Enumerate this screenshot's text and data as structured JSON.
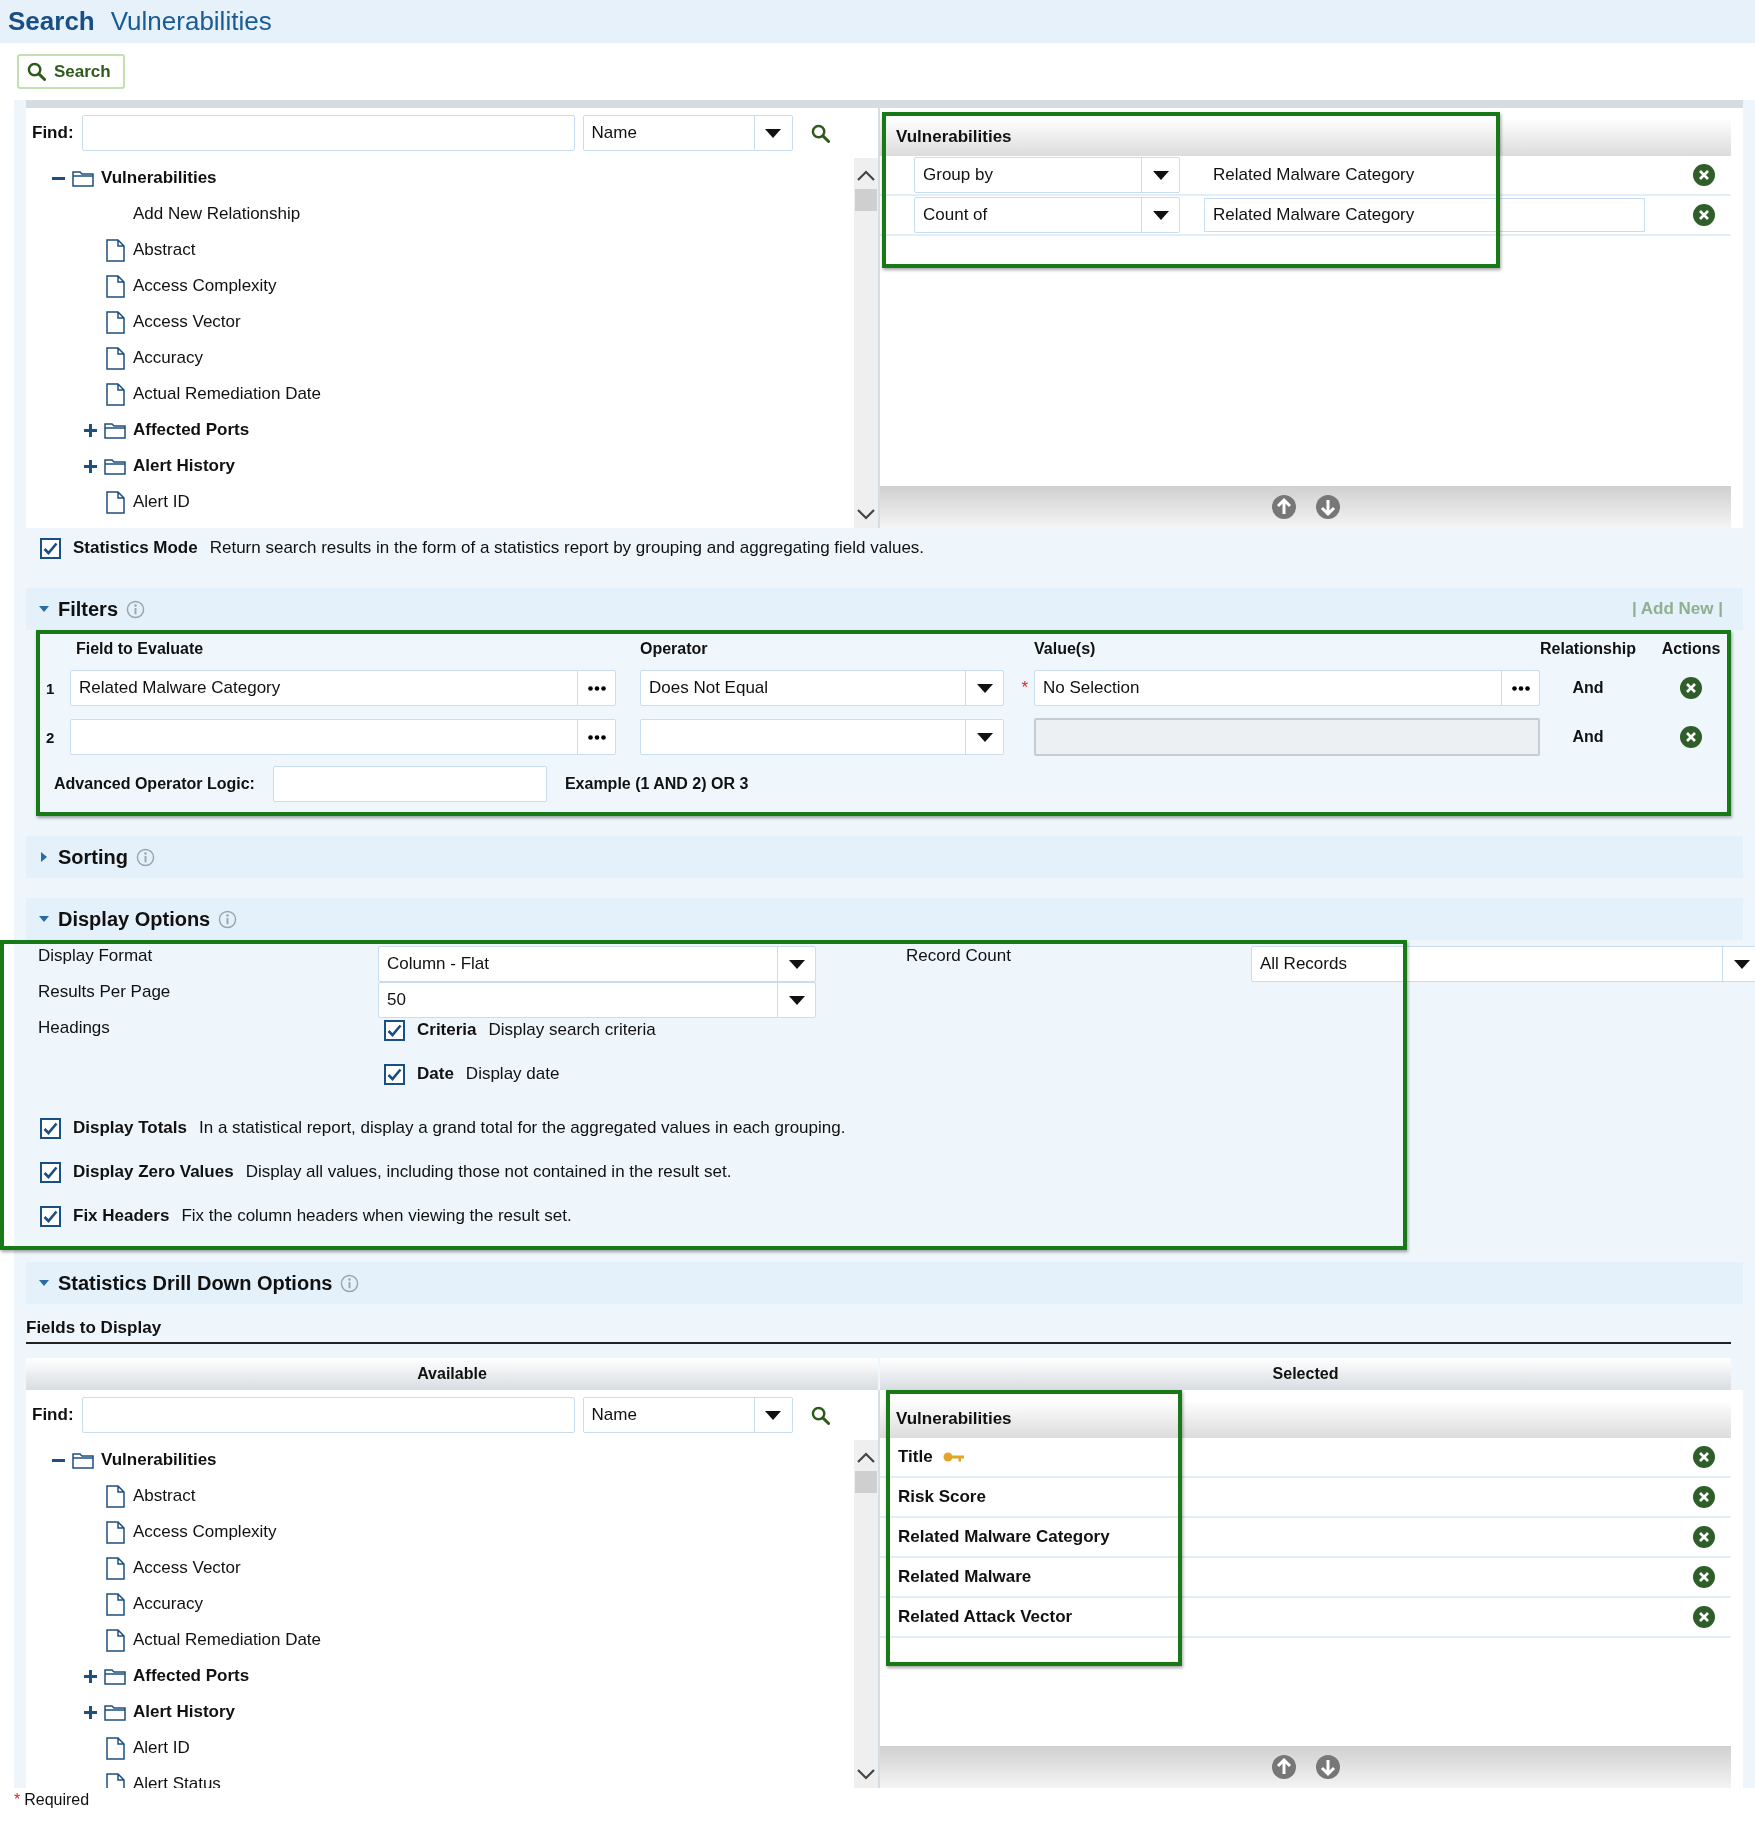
{
  "header": {
    "title": "Search",
    "subtitle": "Vulnerabilities"
  },
  "toolbar": {
    "search_button": "Search"
  },
  "field_selection": {
    "find": {
      "label": "Find:",
      "search_by": "Name"
    },
    "tree": [
      {
        "kind": "folder",
        "label": "Vulnerabilities",
        "expanded": true,
        "children": [
          {
            "kind": "action",
            "label": "Add New Relationship"
          },
          {
            "kind": "field",
            "label": "Abstract"
          },
          {
            "kind": "field",
            "label": "Access Complexity"
          },
          {
            "kind": "field",
            "label": "Access Vector"
          },
          {
            "kind": "field",
            "label": "Accuracy"
          },
          {
            "kind": "field",
            "label": "Actual Remediation Date"
          },
          {
            "kind": "folder",
            "label": "Affected Ports",
            "expanded": false
          },
          {
            "kind": "folder",
            "label": "Alert History",
            "expanded": false
          },
          {
            "kind": "field",
            "label": "Alert ID"
          }
        ]
      }
    ],
    "selected": {
      "title": "Vulnerabilities",
      "rows": [
        {
          "mode": "Group by",
          "field": "Related Malware Category",
          "editable": false
        },
        {
          "mode": "Count of",
          "field": "Related Malware Category",
          "editable": true
        }
      ]
    }
  },
  "statistics_mode": {
    "checked": true,
    "label": "Statistics Mode",
    "description": "Return search results in the form of a statistics report by grouping and aggregating field values."
  },
  "filters": {
    "title": "Filters",
    "expanded": true,
    "add_new": "| Add New |",
    "required_mark": "*",
    "columns": [
      "Field to Evaluate",
      "Operator",
      "Value(s)",
      "Relationship",
      "Actions"
    ],
    "rows": [
      {
        "number": "1",
        "field": "Related Malware Category",
        "operator": "Does Not Equal",
        "required": true,
        "value": "No Selection",
        "value_disabled": false,
        "relationship": "And"
      },
      {
        "number": "2",
        "value_disabled": true,
        "relationship": "And"
      }
    ],
    "advanced_logic": {
      "label": "Advanced Operator Logic:",
      "example": "Example (1 AND 2) OR 3"
    }
  },
  "sorting": {
    "title": "Sorting",
    "expanded": false
  },
  "display_options": {
    "title": "Display Options",
    "expanded": true,
    "display_format": {
      "label": "Display Format",
      "value": "Column - Flat"
    },
    "results_per_page": {
      "label": "Results Per Page",
      "value": "50"
    },
    "record_count": {
      "label": "Record Count",
      "value": "All Records"
    },
    "headings": {
      "label": "Headings",
      "options": [
        {
          "label": "Criteria",
          "description": "Display search criteria",
          "checked": true
        },
        {
          "label": "Date",
          "description": "Display date",
          "checked": true
        }
      ]
    },
    "options": [
      {
        "label": "Display Totals",
        "description": "In a statistical report, display a grand total for the aggregated values in each grouping.",
        "checked": true
      },
      {
        "label": "Display Zero Values",
        "description": "Display all values, including those not contained in the result set.",
        "checked": true
      },
      {
        "label": "Fix Headers",
        "description": "Fix the column headers when viewing the result set.",
        "checked": true
      }
    ]
  },
  "drill_down": {
    "title": "Statistics Drill Down Options",
    "expanded": true,
    "fields_heading": "Fields to Display",
    "available_heading": "Available",
    "selected_heading": "Selected",
    "find": {
      "label": "Find:",
      "search_by": "Name"
    },
    "tree": [
      {
        "kind": "folder",
        "label": "Vulnerabilities",
        "expanded": true,
        "children": [
          {
            "kind": "field",
            "label": "Abstract"
          },
          {
            "kind": "field",
            "label": "Access Complexity"
          },
          {
            "kind": "field",
            "label": "Access Vector"
          },
          {
            "kind": "field",
            "label": "Accuracy"
          },
          {
            "kind": "field",
            "label": "Actual Remediation Date"
          },
          {
            "kind": "folder",
            "label": "Affected Ports",
            "expanded": false
          },
          {
            "kind": "folder",
            "label": "Alert History",
            "expanded": false
          },
          {
            "kind": "field",
            "label": "Alert ID"
          },
          {
            "kind": "field",
            "label": "Alert Status"
          }
        ]
      }
    ],
    "selected": {
      "title": "Vulnerabilities",
      "fields": [
        {
          "label": "Title",
          "key": true
        },
        {
          "label": "Risk Score",
          "key": false
        },
        {
          "label": "Related Malware Category",
          "key": false
        },
        {
          "label": "Related Malware",
          "key": false
        },
        {
          "label": "Related Attack Vector",
          "key": false
        }
      ]
    }
  },
  "footer": {
    "required_mark": "*",
    "required_note": "Required"
  }
}
